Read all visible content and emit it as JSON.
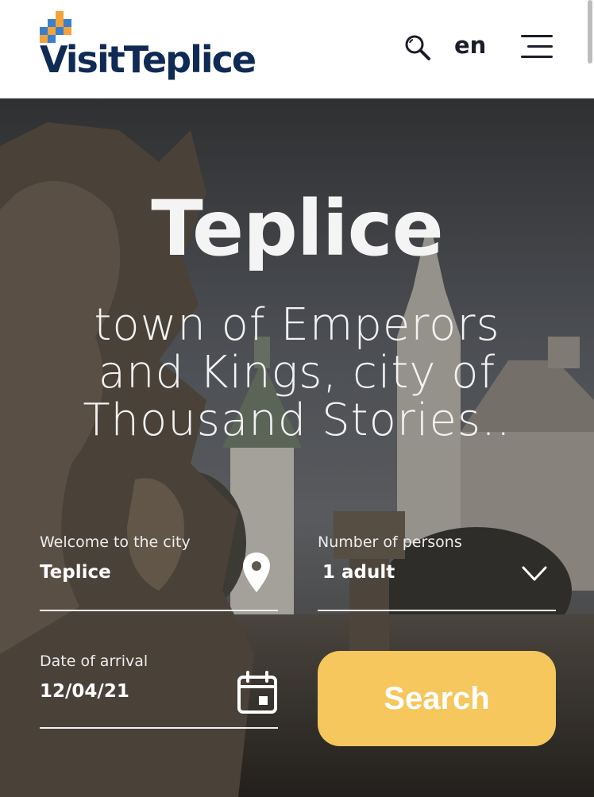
{
  "header": {
    "brand": "VisitTeplice",
    "language": "en",
    "search_icon": "search-icon",
    "menu_icon": "hamburger-menu-icon"
  },
  "hero": {
    "title": "Teplice",
    "subtitle": "town of Emperors and Kings, city of Thousand Stories.."
  },
  "form": {
    "city_label": "Welcome to the city",
    "city_value": "Teplice",
    "city_icon": "location-pin-icon",
    "persons_label": "Number of persons",
    "persons_value": "1 adult",
    "persons_icon": "chevron-down-icon",
    "arrival_label": "Date of arrival",
    "arrival_value": "12/04/21",
    "arrival_icon": "calendar-icon",
    "search_label": "Search"
  },
  "colors": {
    "brand_navy": "#0f2a55",
    "button_yellow": "#f5c75c",
    "logo_blue": "#3b7fd0",
    "logo_orange": "#f2a43a"
  }
}
